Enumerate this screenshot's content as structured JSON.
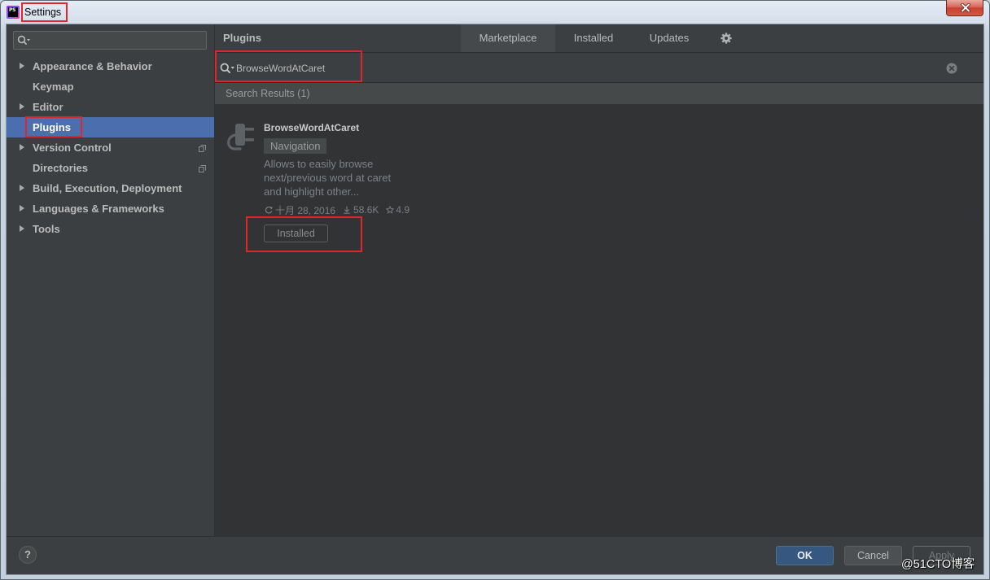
{
  "window": {
    "app_icon": "PS",
    "title": "Settings",
    "close_icon": "close-icon"
  },
  "sidebar": {
    "search_icon": "search-icon",
    "items": [
      {
        "label": "Appearance & Behavior",
        "expandable": true,
        "selected": false
      },
      {
        "label": "Keymap",
        "expandable": false,
        "selected": false
      },
      {
        "label": "Editor",
        "expandable": true,
        "selected": false
      },
      {
        "label": "Plugins",
        "expandable": false,
        "selected": true
      },
      {
        "label": "Version Control",
        "expandable": true,
        "selected": false,
        "project_level": true
      },
      {
        "label": "Directories",
        "expandable": false,
        "selected": false,
        "project_level": true
      },
      {
        "label": "Build, Execution, Deployment",
        "expandable": true,
        "selected": false
      },
      {
        "label": "Languages & Frameworks",
        "expandable": true,
        "selected": false
      },
      {
        "label": "Tools",
        "expandable": true,
        "selected": false
      }
    ]
  },
  "plugins_panel": {
    "title": "Plugins",
    "tabs": [
      {
        "label": "Marketplace",
        "selected": true
      },
      {
        "label": "Installed",
        "selected": false
      },
      {
        "label": "Updates",
        "selected": false
      }
    ],
    "settings_icon": "gear-icon",
    "search": {
      "value": "BrowseWordAtCaret",
      "search_icon": "search-icon",
      "clear_icon": "clear-icon"
    },
    "results_header": "Search Results (1)",
    "results": [
      {
        "icon": "plugin-plug-icon",
        "name": "BrowseWordAtCaret",
        "tag": "Navigation",
        "description": [
          "Allows to easily browse",
          "next/previous word at caret",
          "and highlight other..."
        ],
        "updated_date": "十月 28, 2016",
        "downloads": "58.6K",
        "rating": "4.9",
        "action_button": "Installed"
      }
    ]
  },
  "footer": {
    "help_label": "?",
    "ok_label": "OK",
    "cancel_label": "Cancel",
    "apply_label": "Apply",
    "apply_disabled": true
  },
  "watermark": "@51CTO博客",
  "colors": {
    "panel_bg": "#3c3f41",
    "list_bg": "#313335",
    "selection": "#4b6eaf",
    "default_button": "#365880",
    "close_button": "#c84131",
    "annotation_red": "#e0262b"
  }
}
